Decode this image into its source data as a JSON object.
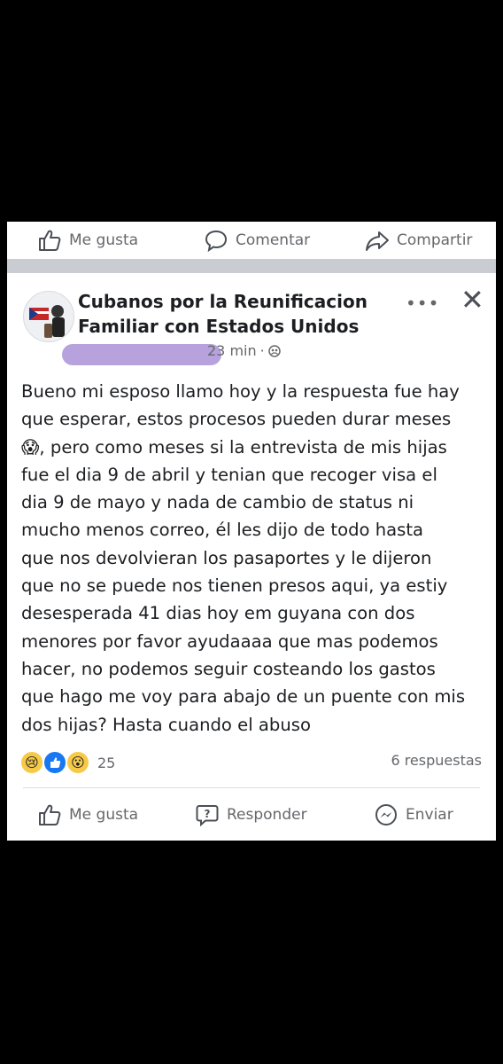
{
  "top_actions": {
    "like": "Me gusta",
    "comment": "Comentar",
    "share": "Compartir"
  },
  "post": {
    "group_name": "Cubanos por la Reunificacion Familiar con Estados Unidos",
    "time": "23 min",
    "separator": "·",
    "text": "Bueno mi esposo llamo hoy y la respuesta fue hay\nque esperar, estos procesos pueden durar meses\n😱, pero como meses si la entrevista de mis hijas\nfue el dia 9 de abril y tenian que recoger visa el\ndia 9 de mayo y nada de cambio de status ni\nmucho menos correo, él les dijo de todo hasta\nque nos devolvieran los pasaportes y le dijeron\nque no se puede nos tienen presos aqui, ya estiy\ndesesperada 41 dias hoy em guyana con dos\nmenores por favor ayudaaaa que mas podemos\nhacer, no podemos seguir costeando los gastos\nque hago me voy para abajo de un puente con mis\ndos hijas? Hasta cuando el abuso",
    "reaction_count": "25",
    "replies": "6 respuestas",
    "reactions": [
      "sad",
      "like",
      "wow"
    ]
  },
  "bottom_actions": {
    "like": "Me gusta",
    "reply": "Responder",
    "send": "Enviar"
  },
  "colors": {
    "text": "#1c1e21",
    "muted": "#65676b",
    "redaction": "#b39ddb",
    "separator": "#c9ccd1"
  }
}
